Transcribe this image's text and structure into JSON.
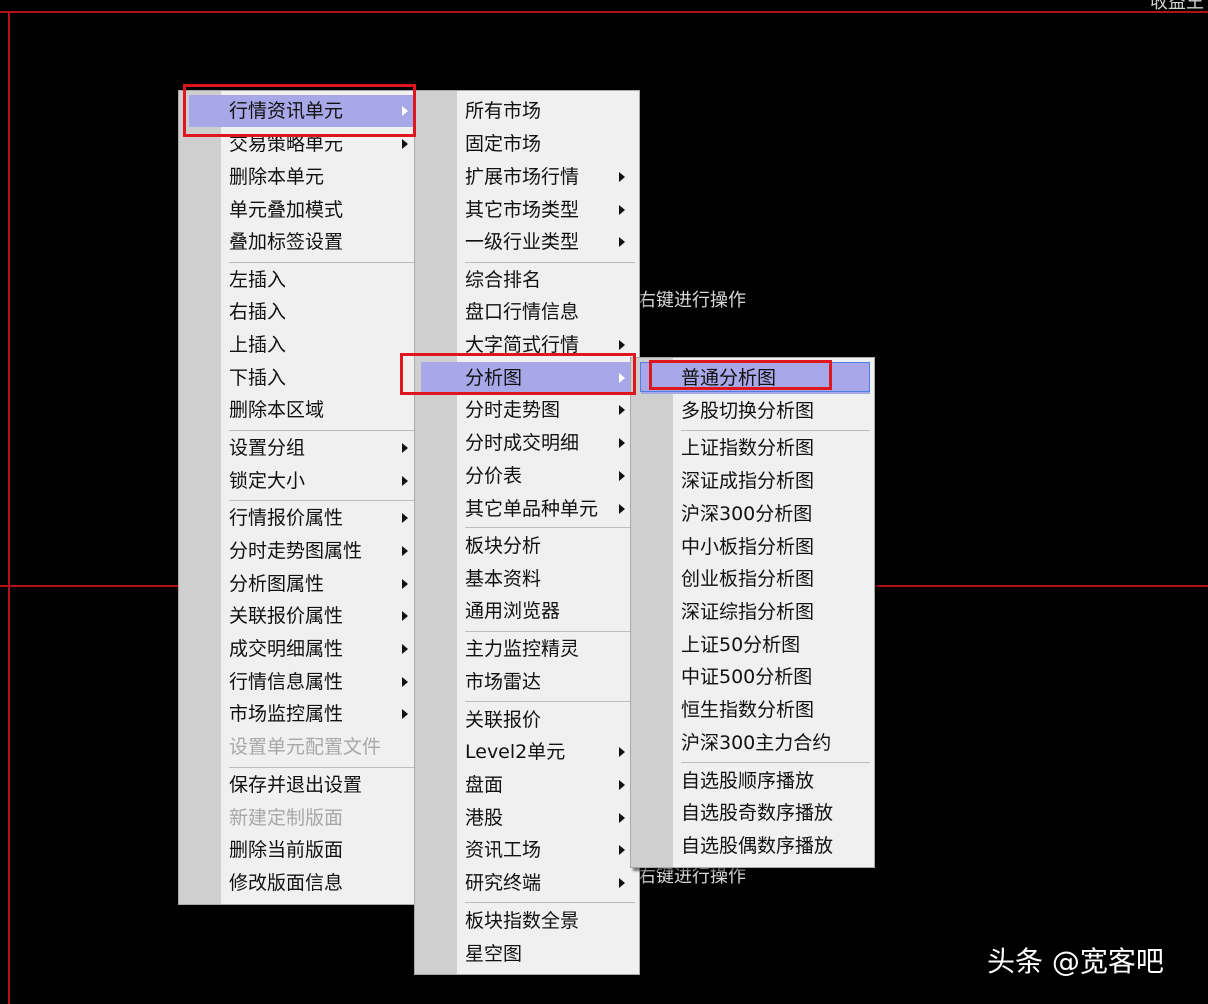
{
  "background": {
    "hint_text_1": "点右键进行操作",
    "hint_text_2": "点右键进行操作",
    "corner_text": "收益王"
  },
  "watermark": "头条 @宽客吧",
  "menu1": {
    "items": [
      {
        "label": "行情资讯单元",
        "arrow": true,
        "highlight": true
      },
      {
        "label": "交易策略单元",
        "arrow": true
      },
      {
        "label": "删除本单元"
      },
      {
        "label": "单元叠加模式"
      },
      {
        "label": "叠加标签设置"
      },
      {
        "label": "左插入"
      },
      {
        "label": "右插入"
      },
      {
        "label": "上插入"
      },
      {
        "label": "下插入"
      },
      {
        "label": "删除本区域"
      },
      {
        "label": "设置分组",
        "arrow": true
      },
      {
        "label": "锁定大小",
        "arrow": true
      },
      {
        "label": "行情报价属性",
        "arrow": true
      },
      {
        "label": "分时走势图属性",
        "arrow": true
      },
      {
        "label": "分析图属性",
        "arrow": true
      },
      {
        "label": "关联报价属性",
        "arrow": true
      },
      {
        "label": "成交明细属性",
        "arrow": true
      },
      {
        "label": "行情信息属性",
        "arrow": true
      },
      {
        "label": "市场监控属性",
        "arrow": true
      },
      {
        "label": "设置单元配置文件",
        "disabled": true
      },
      {
        "label": "保存并退出设置"
      },
      {
        "label": "新建定制版面",
        "disabled": true
      },
      {
        "label": "删除当前版面"
      },
      {
        "label": "修改版面信息"
      }
    ]
  },
  "menu2": {
    "items": [
      {
        "label": "所有市场"
      },
      {
        "label": "固定市场"
      },
      {
        "label": "扩展市场行情",
        "arrow": true
      },
      {
        "label": "其它市场类型",
        "arrow": true
      },
      {
        "label": "一级行业类型",
        "arrow": true
      },
      {
        "label": "综合排名"
      },
      {
        "label": "盘口行情信息"
      },
      {
        "label": "大字简式行情",
        "arrow": true
      },
      {
        "label": "分析图",
        "arrow": true,
        "highlight": true
      },
      {
        "label": "分时走势图",
        "arrow": true
      },
      {
        "label": "分时成交明细",
        "arrow": true
      },
      {
        "label": "分价表",
        "arrow": true
      },
      {
        "label": "其它单品种单元",
        "arrow": true
      },
      {
        "label": "板块分析"
      },
      {
        "label": "基本资料"
      },
      {
        "label": "通用浏览器"
      },
      {
        "label": "主力监控精灵"
      },
      {
        "label": "市场雷达"
      },
      {
        "label": "关联报价"
      },
      {
        "label": "Level2单元",
        "arrow": true
      },
      {
        "label": "盘面",
        "arrow": true
      },
      {
        "label": "港股",
        "arrow": true
      },
      {
        "label": "资讯工场",
        "arrow": true
      },
      {
        "label": "研究终端",
        "arrow": true
      },
      {
        "label": "板块指数全景"
      },
      {
        "label": "星空图"
      }
    ]
  },
  "menu3": {
    "items": [
      {
        "label": "普通分析图",
        "highlight": true
      },
      {
        "label": "多股切换分析图"
      },
      {
        "label": "上证指数分析图"
      },
      {
        "label": "深证成指分析图"
      },
      {
        "label": "沪深300分析图"
      },
      {
        "label": "中小板指分析图"
      },
      {
        "label": "创业板指分析图"
      },
      {
        "label": "深证综指分析图"
      },
      {
        "label": "上证50分析图"
      },
      {
        "label": "中证500分析图"
      },
      {
        "label": "恒生指数分析图"
      },
      {
        "label": "沪深300主力合约"
      },
      {
        "label": "自选股顺序播放"
      },
      {
        "label": "自选股奇数序播放"
      },
      {
        "label": "自选股偶数序播放"
      }
    ]
  }
}
